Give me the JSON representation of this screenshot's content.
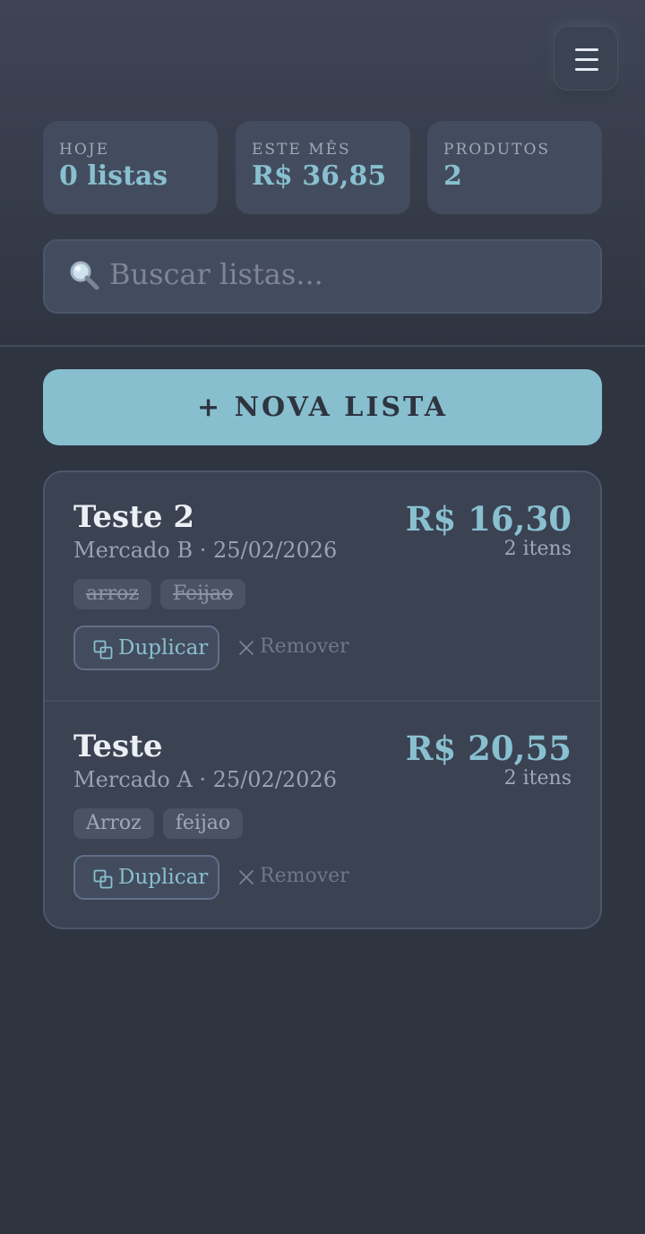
{
  "header": {
    "menu_icon": "hamburger-menu-icon",
    "stats": [
      {
        "label": "HOJE",
        "value": "0 listas"
      },
      {
        "label": "ESTE MÊS",
        "value": "R$ 36,85"
      },
      {
        "label": "PRODUTOS",
        "value": "2"
      }
    ],
    "search": {
      "icon": "search-icon",
      "placeholder": "Buscar listas..."
    }
  },
  "main": {
    "new_list_label": "+ NOVA LISTA",
    "lists": [
      {
        "name": "Teste 2",
        "meta": "Mercado B · 25/02/2026",
        "total": "R$ 16,30",
        "count": "2 itens",
        "tags": [
          {
            "label": "arroz",
            "checked": true
          },
          {
            "label": "Feijao",
            "checked": true
          }
        ],
        "duplicate_label": "Duplicar",
        "remove_label": "Remover"
      },
      {
        "name": "Teste",
        "meta": "Mercado A · 25/02/2026",
        "total": "R$ 20,55",
        "count": "2 itens",
        "tags": [
          {
            "label": "Arroz",
            "checked": false
          },
          {
            "label": "feijao",
            "checked": false
          }
        ],
        "duplicate_label": "Duplicar",
        "remove_label": "Remover"
      }
    ]
  },
  "colors": {
    "background": "#2e3440",
    "surface": "#3b4252",
    "accent": "#88c0d0",
    "text": "#eceff4",
    "muted": "#a0a8b8"
  }
}
